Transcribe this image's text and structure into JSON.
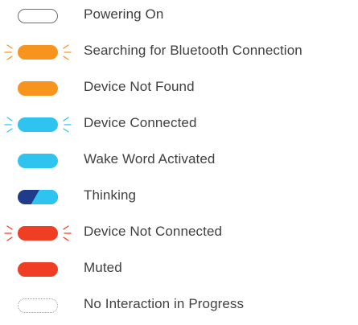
{
  "colors": {
    "orange": "#f7941d",
    "light_blue": "#2fc4ef",
    "navy": "#1f3c8c",
    "red": "#ef3e23",
    "outline_gray": "#6e6e6e",
    "dotted_gray": "#9a9a9a",
    "text": "#404040"
  },
  "states": [
    {
      "label": "Powering On",
      "style": "outline",
      "icon": "outlined-pill-icon"
    },
    {
      "label": "Searching for Bluetooth Connection",
      "style": "solid-pulsing",
      "color": "#f7941d",
      "icon": "pulsing-orange-pill-icon"
    },
    {
      "label": "Device Not Found",
      "style": "solid",
      "color": "#f7941d",
      "icon": "orange-pill-icon"
    },
    {
      "label": "Device Connected",
      "style": "solid-pulsing",
      "color": "#2fc4ef",
      "icon": "pulsing-light-blue-pill-icon"
    },
    {
      "label": "Wake Word Activated",
      "style": "solid",
      "color": "#2fc4ef",
      "icon": "light-blue-pill-icon"
    },
    {
      "label": "Thinking",
      "style": "split",
      "colors": [
        "#1f3c8c",
        "#2fc4ef"
      ],
      "icon": "navy-light-blue-split-pill-icon"
    },
    {
      "label": "Device Not Connected",
      "style": "solid-pulsing",
      "color": "#ef3e23",
      "icon": "pulsing-red-pill-icon"
    },
    {
      "label": "Muted",
      "style": "solid",
      "color": "#ef3e23",
      "icon": "red-pill-icon"
    },
    {
      "label": "No Interaction in Progress",
      "style": "dotted",
      "icon": "dotted-pill-icon"
    }
  ]
}
